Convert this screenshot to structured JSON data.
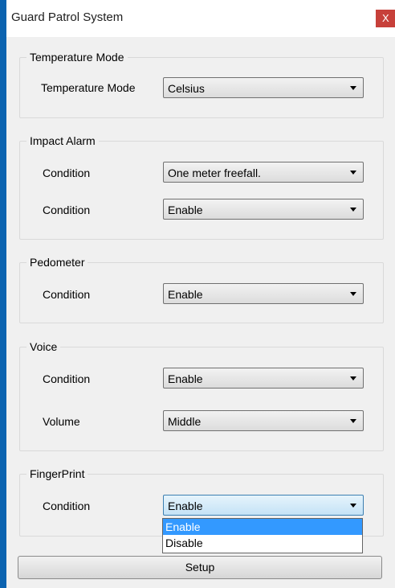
{
  "window": {
    "title": "Guard Patrol System",
    "close_label": "X"
  },
  "temperature": {
    "group_title": "Temperature Mode",
    "mode_label": "Temperature Mode",
    "mode_value": "Celsius"
  },
  "impact_alarm": {
    "group_title": "Impact Alarm",
    "condition1_label": "Condition",
    "condition1_value": "One meter freefall.",
    "condition2_label": "Condition",
    "condition2_value": "Enable"
  },
  "pedometer": {
    "group_title": "Pedometer",
    "condition_label": "Condition",
    "condition_value": "Enable"
  },
  "voice": {
    "group_title": "Voice",
    "condition_label": "Condition",
    "condition_value": "Enable",
    "volume_label": "Volume",
    "volume_value": "Middle"
  },
  "fingerprint": {
    "group_title": "FingerPrint",
    "condition_label": "Condition",
    "condition_value": "Enable",
    "options": [
      "Enable",
      "Disable"
    ]
  },
  "setup_button": "Setup"
}
